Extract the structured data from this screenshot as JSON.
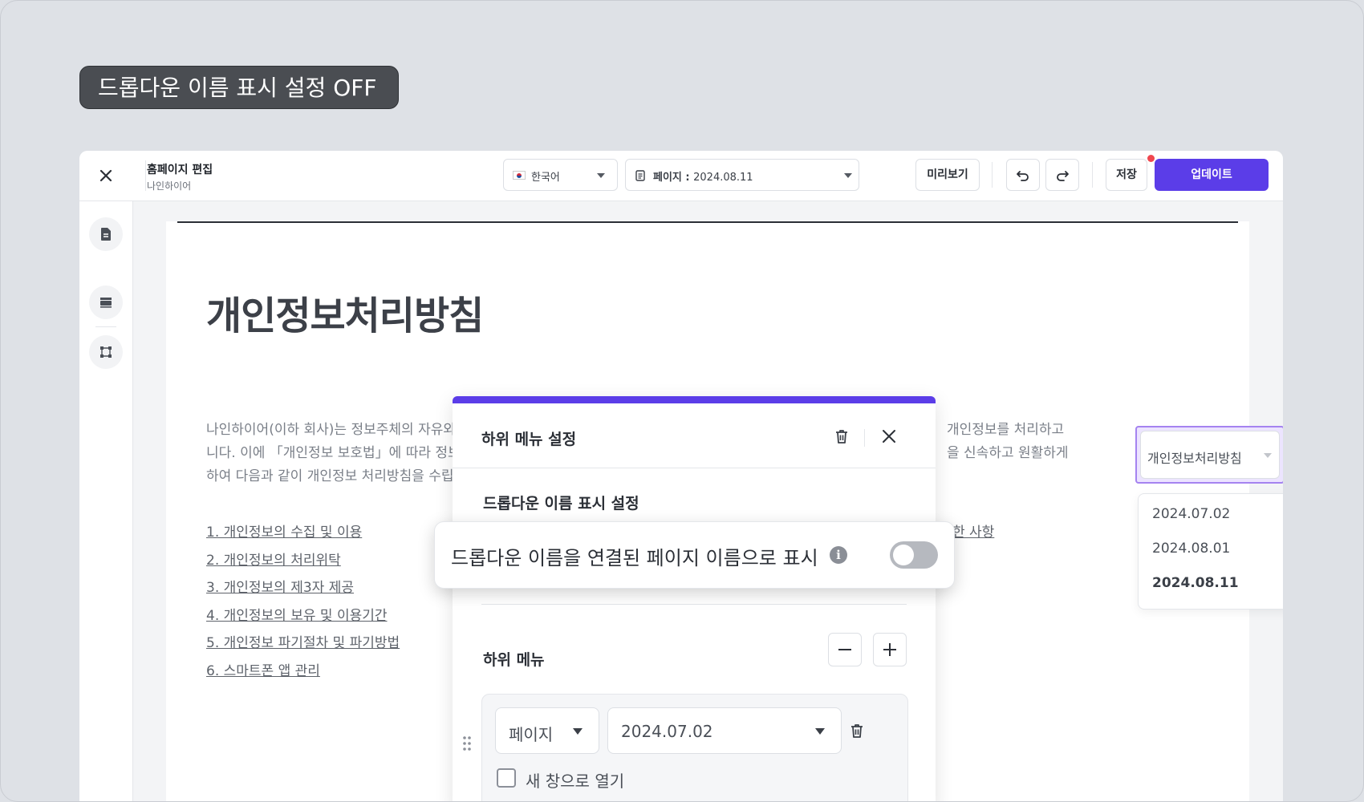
{
  "caption": "드롭다운 이름 표시 설정 OFF",
  "topbar": {
    "title": "홈페이지 편집",
    "subtitle": "나인하이어",
    "language": "한국어",
    "page_prefix": "페이지 : ",
    "page_value": "2024.08.11",
    "preview_label": "미리보기",
    "save_label": "저장",
    "update_label": "업데이트"
  },
  "canvas": {
    "title": "개인정보처리방침",
    "paragraph": [
      "나인하이어(이하 회사)는 정보주체의 자유와",
      "니다. 이에 「개인정보 보호법」에 따라 정보주",
      "하여 다음과 같이 개인정보 처리방침을 수립"
    ],
    "paragraph_right": [
      "개인정보를 처리하고",
      "을 신속하고 원활하게"
    ],
    "links": [
      "1. 개인정보의 수집 및 이용",
      "2. 개인정보의 처리위탁",
      "3. 개인정보의 제3자 제공",
      "4. 개인정보의 보유 및 이용기간",
      "5. 개인정보 파기절차 및 파기방법",
      "6. 스마트폰 앱 관리"
    ],
    "link_right": "한 사항",
    "dropdown_label": "개인정보처리방침",
    "dropdown_options": [
      "2024.07.02",
      "2024.08.01",
      "2024.08.11"
    ]
  },
  "modal": {
    "title": "하위 메뉴 설정",
    "section_title": "드롭다운 이름 표시 설정",
    "submenu_title": "하위 메뉴",
    "row_type": "페이지",
    "row_page": "2024.07.02",
    "open_new_window": "새 창으로 열기"
  },
  "popover": {
    "label": "드롭다운 이름을 연결된 페이지 이름으로 표시",
    "toggle_on": false
  },
  "colors": {
    "accent": "#5b3de8",
    "highlight": "#a583f0",
    "notification": "#f0474f"
  }
}
